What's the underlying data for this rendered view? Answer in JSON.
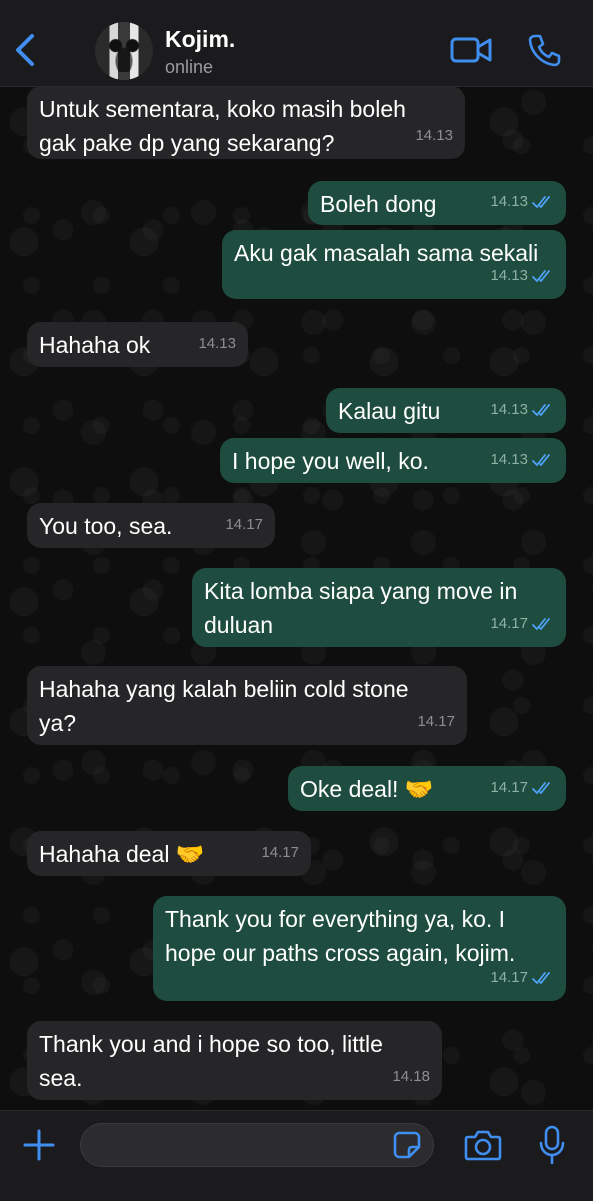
{
  "header": {
    "contact_name": "Kojim.",
    "status": "online"
  },
  "colors": {
    "accent": "#3f8ef0",
    "outgoing_bubble": "#1e4d3f",
    "incoming_bubble": "#262628",
    "read_ticks": "#4fa3f7"
  },
  "icons": [
    "chevron-left-icon",
    "video-call-icon",
    "phone-icon",
    "plus-icon",
    "sticker-icon",
    "camera-icon",
    "microphone-icon",
    "double-check-icon"
  ],
  "messages": [
    {
      "dir": "in",
      "text": "Untuk sementara, koko masih boleh\ngak pake dp yang sekarang?",
      "time": "14.13"
    },
    {
      "dir": "out",
      "text": "Boleh dong",
      "time": "14.13"
    },
    {
      "dir": "out",
      "text": "Aku gak masalah sama sekali",
      "time": "14.13"
    },
    {
      "dir": "in",
      "text": "Hahaha ok",
      "time": "14.13"
    },
    {
      "dir": "out",
      "text": "Kalau gitu",
      "time": "14.13"
    },
    {
      "dir": "out",
      "text": "I hope you well, ko.",
      "time": "14.13"
    },
    {
      "dir": "in",
      "text": "You too, sea.",
      "time": "14.17"
    },
    {
      "dir": "out",
      "text": "Kita lomba siapa yang move in\nduluan",
      "time": "14.17"
    },
    {
      "dir": "in",
      "text": "Hahaha yang kalah beliin cold stone\nya?",
      "time": "14.17"
    },
    {
      "dir": "out",
      "text": "Oke deal! 🤝",
      "time": "14.17"
    },
    {
      "dir": "in",
      "text": "Hahaha deal 🤝",
      "time": "14.17"
    },
    {
      "dir": "out",
      "text": "Thank you for everything ya, ko. I\nhope our paths cross again, kojim.",
      "time": "14.17"
    },
    {
      "dir": "in",
      "text": "Thank you and i hope so too, little\nsea.",
      "time": "14.18"
    }
  ],
  "composer": {
    "placeholder": ""
  }
}
